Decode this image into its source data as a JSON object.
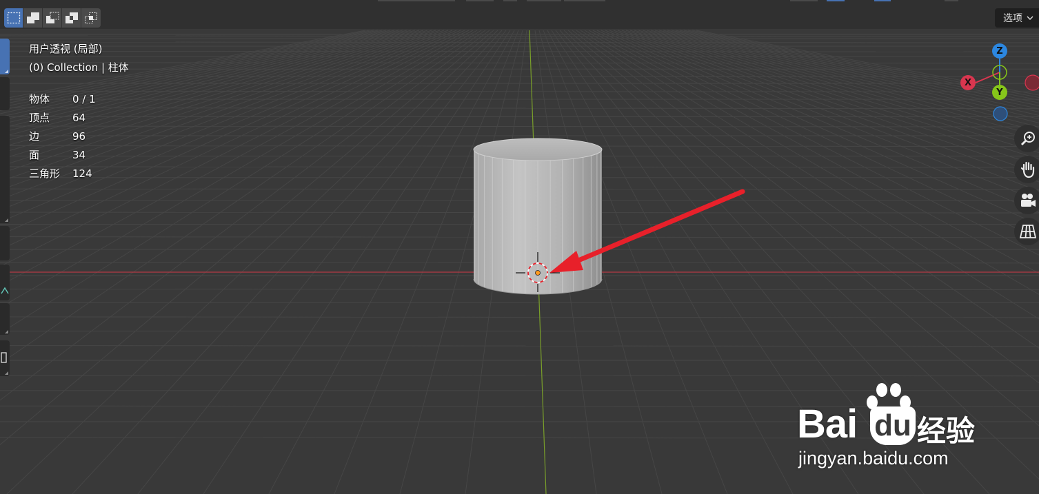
{
  "header": {
    "options_label": "选项",
    "options_chevron_icon": "chevron-down-icon",
    "mode_buttons": [
      {
        "name": "select-set-mode",
        "icon": "dashed-rect-icon",
        "active": true
      },
      {
        "name": "select-extend-mode",
        "icon": "union-icon",
        "active": false
      },
      {
        "name": "select-subtract-mode",
        "icon": "subtract-icon",
        "active": false
      },
      {
        "name": "select-difference-mode",
        "icon": "difference-icon",
        "active": false
      },
      {
        "name": "select-intersect-mode",
        "icon": "intersect-icon",
        "active": false
      }
    ]
  },
  "overlay": {
    "view_name": "用户透视 (局部)",
    "collection_line": "(0) Collection | 柱体"
  },
  "stats": [
    {
      "label": "物体",
      "value": "0 / 1"
    },
    {
      "label": "顶点",
      "value": "64"
    },
    {
      "label": "边",
      "value": "96"
    },
    {
      "label": "面",
      "value": "34"
    },
    {
      "label": "三角形",
      "value": "124"
    }
  ],
  "gizmo": {
    "z_label": "Z",
    "x_label": "X",
    "y_label": "Y",
    "colors": {
      "x": "#d9364f",
      "y": "#86c61a",
      "z": "#2c87e0"
    }
  },
  "nav_buttons": [
    {
      "name": "zoom-button",
      "icon": "zoom-in-icon"
    },
    {
      "name": "pan-button",
      "icon": "hand-icon"
    },
    {
      "name": "camera-view-button",
      "icon": "camera-icon"
    },
    {
      "name": "ortho-toggle-button",
      "icon": "grid-icon"
    }
  ],
  "watermark": {
    "brand_part1": "Bai",
    "brand_part2": "du",
    "brand_suffix": "经验",
    "url": "jingyan.baidu.com"
  },
  "colors": {
    "accent": "#4772b3",
    "annotation_arrow": "#e8202a",
    "x_axis_line": "#b33a44",
    "y_axis_line": "#7aa02a"
  }
}
